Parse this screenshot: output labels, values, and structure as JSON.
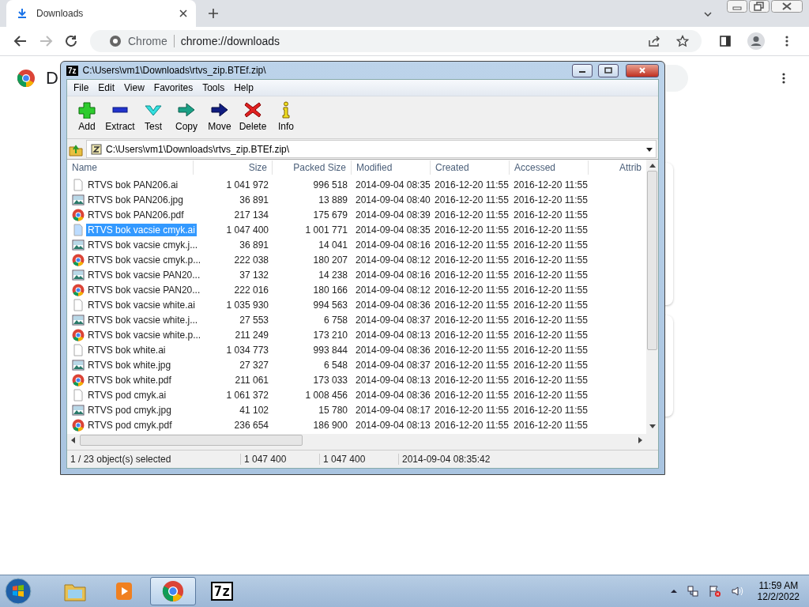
{
  "browser": {
    "tab": {
      "title": "Downloads",
      "selected": true
    },
    "nav_buttons": [
      {
        "kind": "back",
        "disabled": false
      },
      {
        "kind": "forward",
        "disabled": true
      },
      {
        "kind": "reload",
        "disabled": false
      }
    ],
    "address": {
      "site": "Chrome",
      "url": "chrome://downloads"
    }
  },
  "page": {
    "heading": "D"
  },
  "archive_window": {
    "title": "C:\\Users\\vm1\\Downloads\\rtvs_zip.BTEf.zip\\",
    "app_icon_text": "7z",
    "menu": [
      "File",
      "Edit",
      "View",
      "Favorites",
      "Tools",
      "Help"
    ],
    "toolbar": [
      {
        "label": "Add",
        "kind": "add"
      },
      {
        "label": "Extract",
        "kind": "extract"
      },
      {
        "label": "Test",
        "kind": "test"
      },
      {
        "label": "Copy",
        "kind": "copy"
      },
      {
        "label": "Move",
        "kind": "move"
      },
      {
        "label": "Delete",
        "kind": "delete"
      },
      {
        "label": "Info",
        "kind": "info"
      }
    ],
    "path": "C:\\Users\\vm1\\Downloads\\rtvs_zip.BTEf.zip\\",
    "columns": [
      "Name",
      "Size",
      "Packed Size",
      "Modified",
      "Created",
      "Accessed",
      "Attrib"
    ],
    "rows": [
      {
        "name": "RTVS bok PAN206.ai",
        "kind": "document",
        "size": "1 041 972",
        "packed": "996 518",
        "modified": "2014-09-04 08:35",
        "created": "2016-12-20 11:55",
        "accessed": "2016-12-20 11:55",
        "selected": false
      },
      {
        "name": "RTVS bok PAN206.jpg",
        "kind": "image",
        "size": "36 891",
        "packed": "13 889",
        "modified": "2014-09-04 08:40",
        "created": "2016-12-20 11:55",
        "accessed": "2016-12-20 11:55",
        "selected": false
      },
      {
        "name": "RTVS bok PAN206.pdf",
        "kind": "pdf",
        "size": "217 134",
        "packed": "175 679",
        "modified": "2014-09-04 08:39",
        "created": "2016-12-20 11:55",
        "accessed": "2016-12-20 11:55",
        "selected": false
      },
      {
        "name": "RTVS bok vacsie cmyk.ai",
        "kind": "document",
        "size": "1 047 400",
        "packed": "1 001 771",
        "modified": "2014-09-04 08:35",
        "created": "2016-12-20 11:55",
        "accessed": "2016-12-20 11:55",
        "selected": true
      },
      {
        "name": "RTVS bok vacsie cmyk.j...",
        "kind": "image",
        "size": "36 891",
        "packed": "14 041",
        "modified": "2014-09-04 08:16",
        "created": "2016-12-20 11:55",
        "accessed": "2016-12-20 11:55",
        "selected": false
      },
      {
        "name": "RTVS bok vacsie cmyk.p...",
        "kind": "pdf",
        "size": "222 038",
        "packed": "180 207",
        "modified": "2014-09-04 08:12",
        "created": "2016-12-20 11:55",
        "accessed": "2016-12-20 11:55",
        "selected": false
      },
      {
        "name": "RTVS bok vacsie PAN20...",
        "kind": "image",
        "size": "37 132",
        "packed": "14 238",
        "modified": "2014-09-04 08:16",
        "created": "2016-12-20 11:55",
        "accessed": "2016-12-20 11:55",
        "selected": false
      },
      {
        "name": "RTVS bok vacsie PAN20...",
        "kind": "pdf",
        "size": "222 016",
        "packed": "180 166",
        "modified": "2014-09-04 08:12",
        "created": "2016-12-20 11:55",
        "accessed": "2016-12-20 11:55",
        "selected": false
      },
      {
        "name": "RTVS bok vacsie white.ai",
        "kind": "document",
        "size": "1 035 930",
        "packed": "994 563",
        "modified": "2014-09-04 08:36",
        "created": "2016-12-20 11:55",
        "accessed": "2016-12-20 11:55",
        "selected": false
      },
      {
        "name": "RTVS bok vacsie white.j...",
        "kind": "image",
        "size": "27 553",
        "packed": "6 758",
        "modified": "2014-09-04 08:37",
        "created": "2016-12-20 11:55",
        "accessed": "2016-12-20 11:55",
        "selected": false
      },
      {
        "name": "RTVS bok vacsie white.p...",
        "kind": "pdf",
        "size": "211 249",
        "packed": "173 210",
        "modified": "2014-09-04 08:13",
        "created": "2016-12-20 11:55",
        "accessed": "2016-12-20 11:55",
        "selected": false
      },
      {
        "name": "RTVS bok white.ai",
        "kind": "document",
        "size": "1 034 773",
        "packed": "993 844",
        "modified": "2014-09-04 08:36",
        "created": "2016-12-20 11:55",
        "accessed": "2016-12-20 11:55",
        "selected": false
      },
      {
        "name": "RTVS bok white.jpg",
        "kind": "image",
        "size": "27 327",
        "packed": "6 548",
        "modified": "2014-09-04 08:37",
        "created": "2016-12-20 11:55",
        "accessed": "2016-12-20 11:55",
        "selected": false
      },
      {
        "name": "RTVS bok white.pdf",
        "kind": "pdf",
        "size": "211 061",
        "packed": "173 033",
        "modified": "2014-09-04 08:13",
        "created": "2016-12-20 11:55",
        "accessed": "2016-12-20 11:55",
        "selected": false
      },
      {
        "name": "RTVS pod cmyk.ai",
        "kind": "document",
        "size": "1 061 372",
        "packed": "1 008 456",
        "modified": "2014-09-04 08:36",
        "created": "2016-12-20 11:55",
        "accessed": "2016-12-20 11:55",
        "selected": false
      },
      {
        "name": "RTVS pod cmyk.jpg",
        "kind": "image",
        "size": "41 102",
        "packed": "15 780",
        "modified": "2014-09-04 08:17",
        "created": "2016-12-20 11:55",
        "accessed": "2016-12-20 11:55",
        "selected": false
      },
      {
        "name": "RTVS pod cmyk.pdf",
        "kind": "pdf",
        "size": "236 654",
        "packed": "186 900",
        "modified": "2014-09-04 08:13",
        "created": "2016-12-20 11:55",
        "accessed": "2016-12-20 11:55",
        "selected": false
      }
    ],
    "status": [
      "1 / 23 object(s) selected",
      "1 047 400",
      "1 047 400",
      "2014-09-04 08:35:42"
    ]
  },
  "taskbar": {
    "items": [
      {
        "kind": "explorer",
        "selected": false
      },
      {
        "kind": "media",
        "selected": false
      },
      {
        "kind": "chrome",
        "selected": true
      },
      {
        "kind": "sevenzip",
        "label": "7z",
        "selected": false
      }
    ],
    "time": "11:59 AM",
    "date": "12/2/2022"
  }
}
